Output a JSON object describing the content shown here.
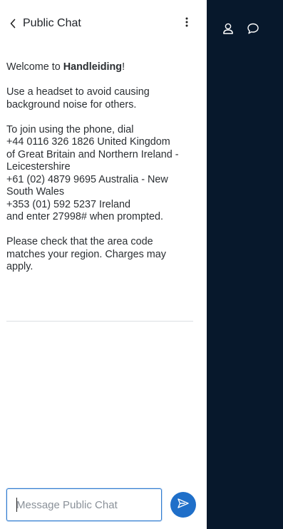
{
  "header": {
    "title": "Public Chat"
  },
  "messages": {
    "welcome_prefix": "Welcome to ",
    "welcome_name": "Handleiding",
    "welcome_suffix": "!",
    "headset_tip_l1": "Use a headset to avoid causing",
    "headset_tip_l2": "background noise for others.",
    "dial_intro": "To join using the phone, dial",
    "dial_uk_l1": "+44 0116 326 1826 United Kingdom",
    "dial_uk_l2": "of Great Britain and Northern Ireland -",
    "dial_uk_l3": "Leicestershire",
    "dial_au_l1": "+61 (02) 4879 9695 Australia - New",
    "dial_au_l2": "South Wales",
    "dial_ie": "+353 (01) 592 5237 Ireland",
    "dial_enter": "and enter 27998# when prompted.",
    "charges_l1": "Please check that the area code",
    "charges_l2": "matches your region. Charges may",
    "charges_l3": "apply."
  },
  "composer": {
    "placeholder": "Message Public Chat",
    "value": ""
  },
  "icons": {
    "back": "chevron-left-icon",
    "options": "more-vertical-icon",
    "send": "send-icon",
    "users": "user-icon",
    "chat": "chat-bubble-icon"
  },
  "colors": {
    "accent": "#1f6fc9",
    "dark_panel": "#07182c"
  }
}
